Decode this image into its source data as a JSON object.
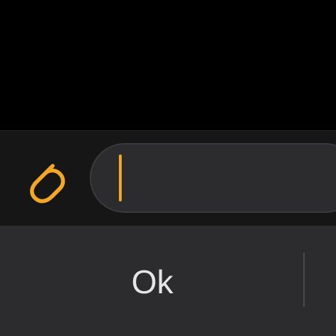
{
  "colors": {
    "background": "#000000",
    "composer_background": "#161616",
    "input_background": "#2c2c2e",
    "input_border": "#3a3a3c",
    "accent": "#f5a623",
    "button_row_background": "#2c2c2e",
    "button_text": "#e5e5e7",
    "divider": "#4a4a4c"
  },
  "composer": {
    "attach_icon": "paperclip-icon",
    "input_value": "",
    "caret_visible": true
  },
  "actions": {
    "ok_label": "Ok"
  }
}
